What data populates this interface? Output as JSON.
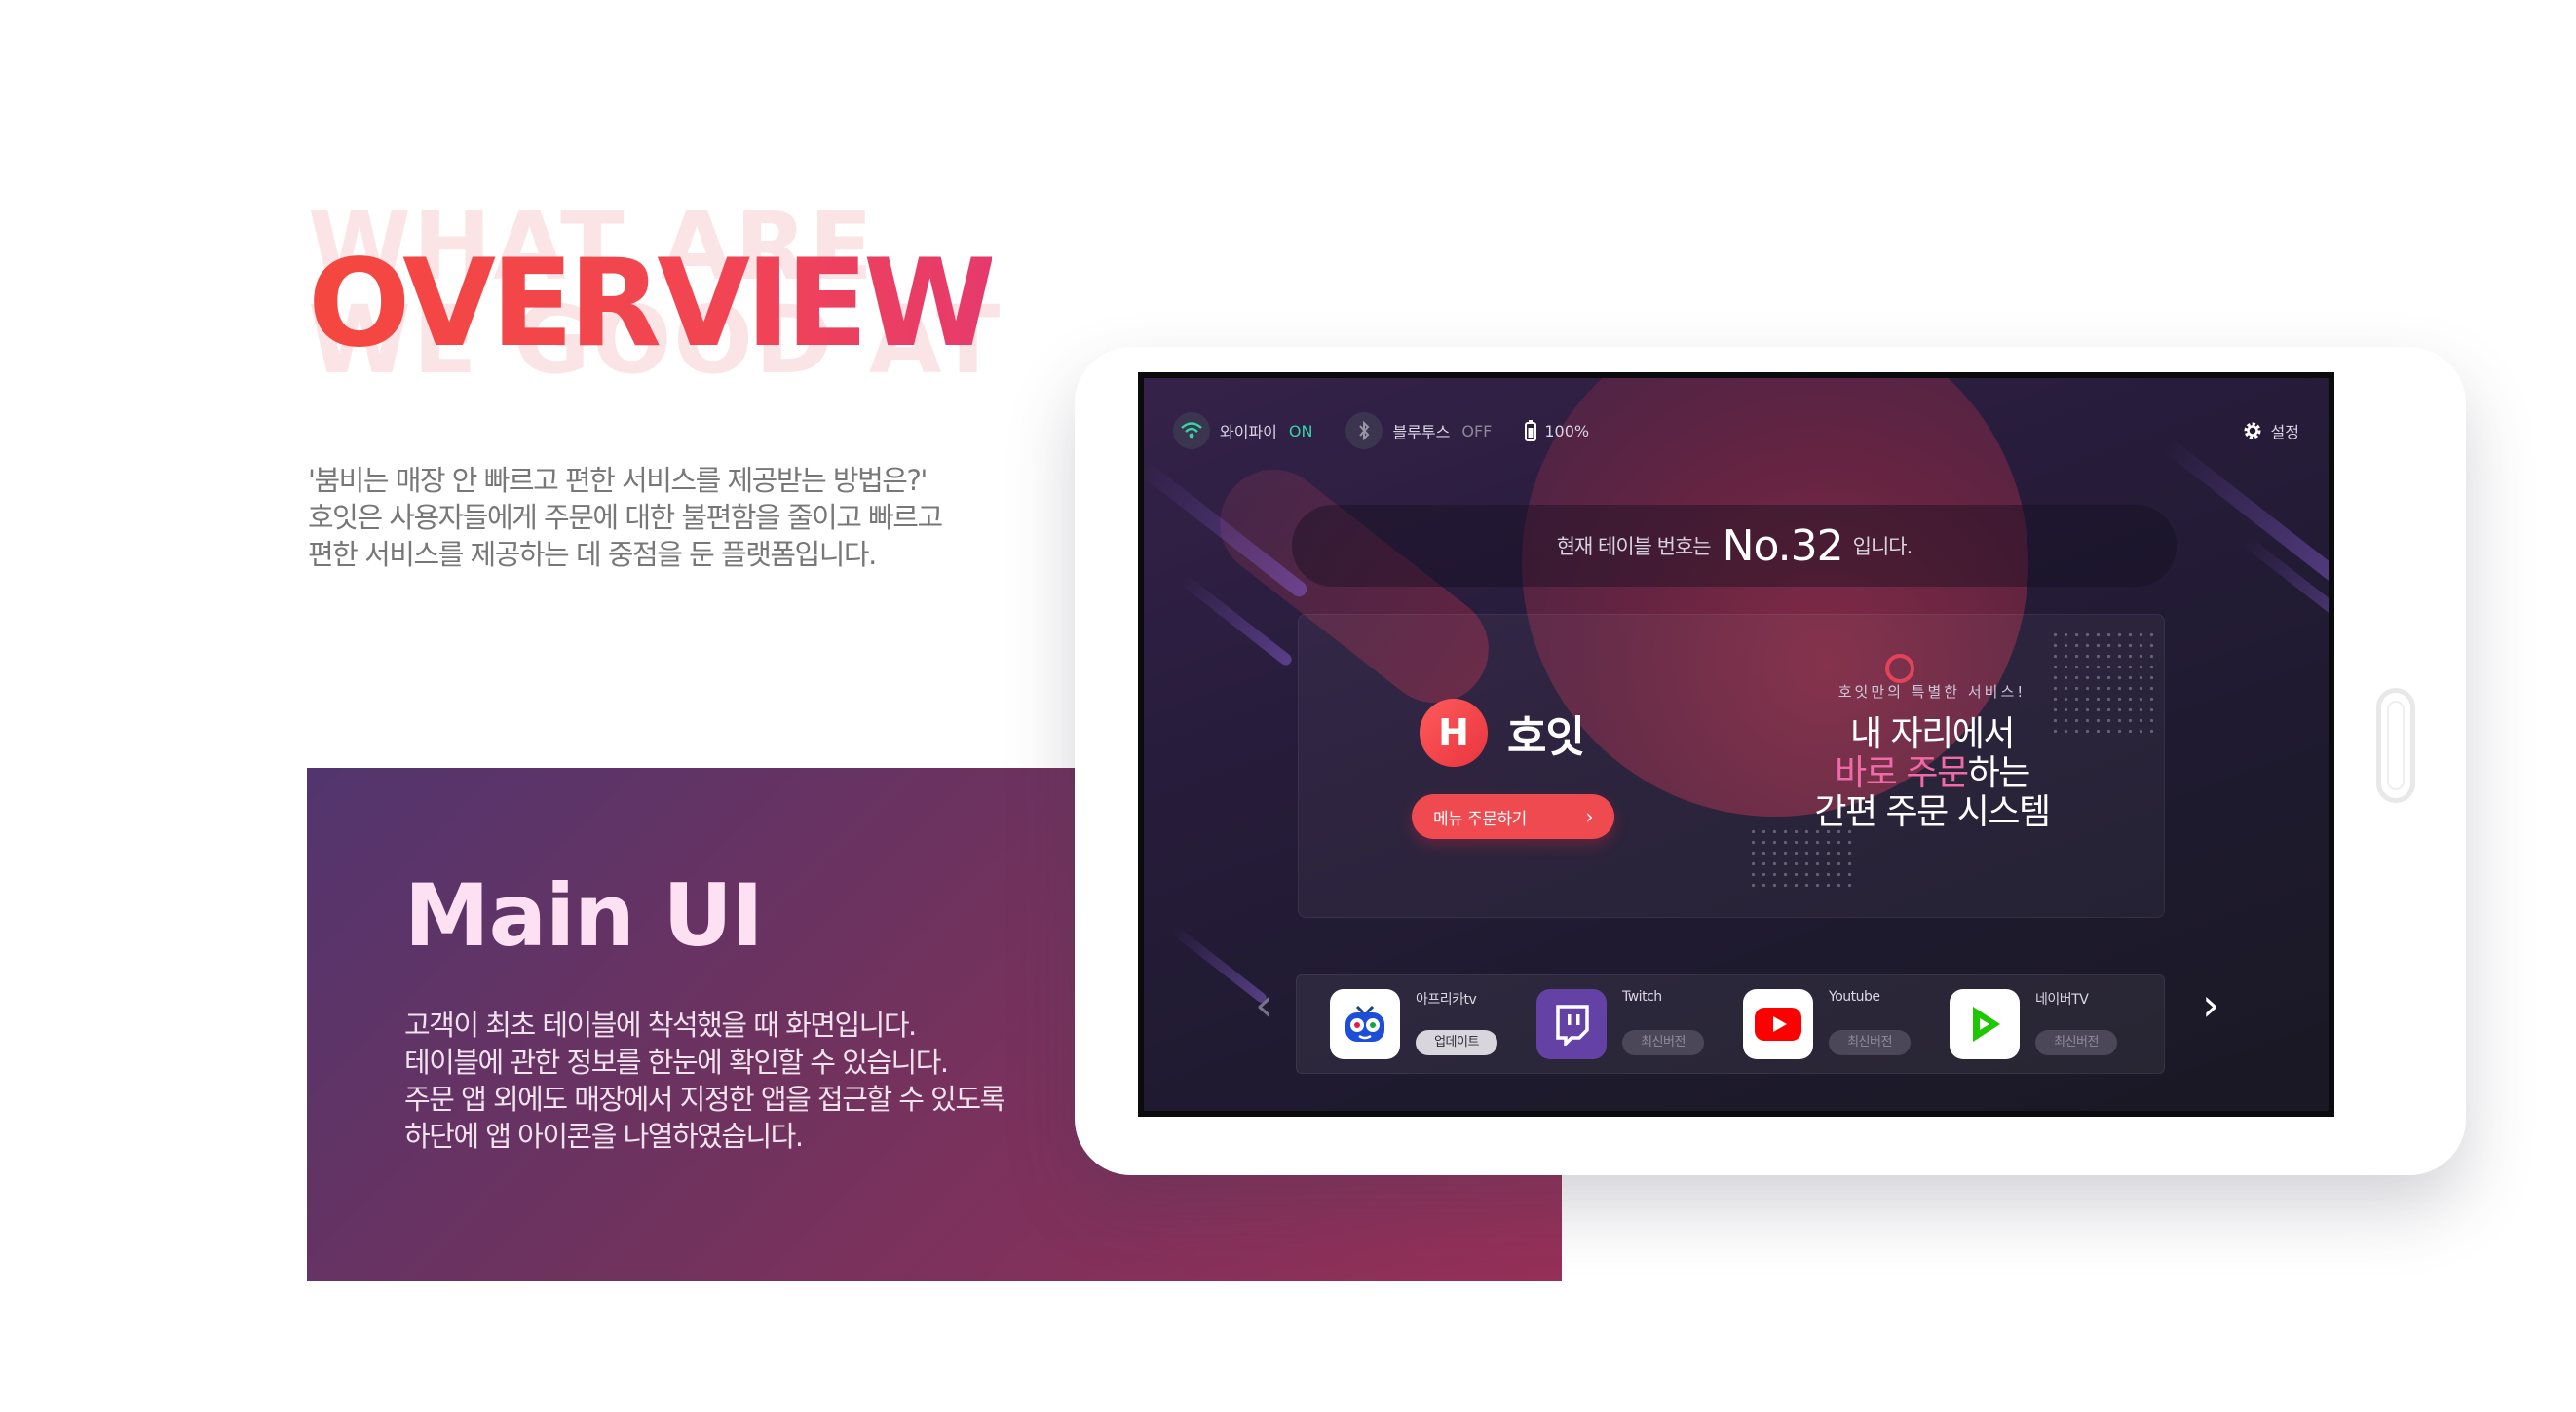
{
  "background_text": [
    "WHAT ARE",
    "WE GOOD AT"
  ],
  "heading": "OVERVIEW",
  "intro": [
    "'붐비는 매장 안 빠르고 편한 서비스를 제공받는 방법은?'",
    "호잇은 사용자들에게 주문에 대한 불편함을 줄이고 빠르고",
    "편한 서비스를 제공하는 데 중점을 둔 플랫폼입니다."
  ],
  "main_card": {
    "title": "Main UI",
    "description": [
      "고객이 최초 테이블에 착석했을 때 화면입니다.",
      "테이블에 관한 정보를 한눈에 확인할 수 있습니다.",
      "주문 앱 외에도 매장에서 지정한 앱을 접근할 수 있도록",
      "하단에 앱 아이콘을 나열하였습니다."
    ]
  },
  "screen": {
    "status": {
      "wifi_label": "와이파이",
      "wifi_state": "ON",
      "bluetooth_label": "블루투스",
      "bluetooth_state": "OFF",
      "battery": "100%",
      "settings_label": "설정"
    },
    "table": {
      "prefix": "현재 테이블 번호는",
      "number": "No.32",
      "suffix": "입니다."
    },
    "hero": {
      "brand_logo_letter": "H",
      "brand_name": "호잇",
      "order_button": "메뉴 주문하기",
      "order_button_arrow": "›",
      "promo_sub": "호잇만의 특별한 서비스!",
      "promo_line1": "내 자리에서",
      "promo_line2_pink": "바로 주문",
      "promo_line2_rest": "하는",
      "promo_line3": "간편 주문 시스템"
    },
    "apps": [
      {
        "name": "아프리카tv",
        "tag": "업데이트",
        "icon": "afreecatv-icon",
        "color": "#ffffff"
      },
      {
        "name": "Twitch",
        "tag": "최신버전",
        "icon": "twitch-icon",
        "color": "#6441a5"
      },
      {
        "name": "Youtube",
        "tag": "최신버전",
        "icon": "youtube-icon",
        "color": "#ff0000"
      },
      {
        "name": "네이버TV",
        "tag": "최신버전",
        "icon": "navertv-icon",
        "color": "#1ec800"
      }
    ],
    "prev_arrow": "‹",
    "next_arrow": "›"
  },
  "colors": {
    "accent_red": "#f0444f",
    "wifi_on": "#35d3a6",
    "promo_pink": "#f06aa8",
    "card_gradient_start": "#52356e",
    "card_gradient_end": "#963058"
  }
}
